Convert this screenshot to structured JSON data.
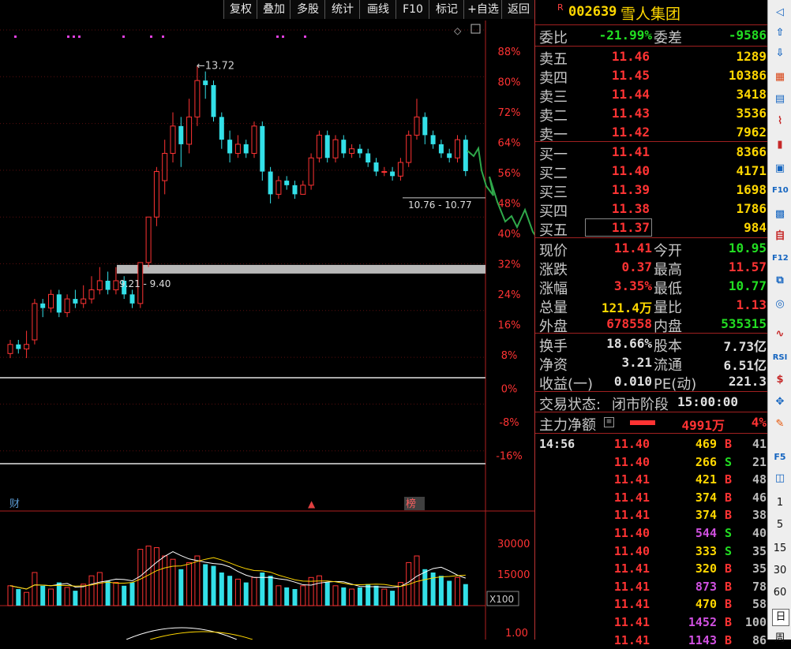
{
  "toolbar": {
    "buttons": [
      "复权",
      "叠加",
      "多股",
      "统计",
      "画线",
      "F10",
      "标记",
      "+自选",
      "返回"
    ]
  },
  "stock": {
    "badge": "R",
    "code": "002639",
    "name": "雪人集团"
  },
  "order_book": {
    "weibi_label": "委比",
    "weibi_value": "-21.99%",
    "weicha_label": "委差",
    "weicha_value": "-9586",
    "sells": [
      {
        "label": "卖五",
        "price": "11.46",
        "vol": "1289"
      },
      {
        "label": "卖四",
        "price": "11.45",
        "vol": "10386"
      },
      {
        "label": "卖三",
        "price": "11.44",
        "vol": "3418"
      },
      {
        "label": "卖二",
        "price": "11.43",
        "vol": "3536"
      },
      {
        "label": "卖一",
        "price": "11.42",
        "vol": "7962"
      }
    ],
    "buys": [
      {
        "label": "买一",
        "price": "11.41",
        "vol": "8366"
      },
      {
        "label": "买二",
        "price": "11.40",
        "vol": "4171"
      },
      {
        "label": "买三",
        "price": "11.39",
        "vol": "1698"
      },
      {
        "label": "买四",
        "price": "11.38",
        "vol": "1786"
      },
      {
        "label": "买五",
        "price": "11.37",
        "vol": "984"
      }
    ]
  },
  "stats": [
    {
      "l1": "现价",
      "v1": "11.41",
      "l2": "今开",
      "v2": "10.95"
    },
    {
      "l1": "涨跌",
      "v1": "0.37",
      "l2": "最高",
      "v2": "11.57"
    },
    {
      "l1": "涨幅",
      "v1": "3.35%",
      "l2": "最低",
      "v2": "10.77"
    },
    {
      "l1": "总量",
      "v1": "121.4万",
      "l2": "量比",
      "v2": "1.13"
    },
    {
      "l1": "外盘",
      "v1": "678558",
      "l2": "内盘",
      "v2": "535315"
    }
  ],
  "stats2": [
    {
      "l1": "换手",
      "v1": "18.66%",
      "l2": "股本",
      "v2": "7.73亿"
    },
    {
      "l1": "净资",
      "v1": "3.21",
      "l2": "流通",
      "v2": "6.51亿"
    },
    {
      "l1": "收益(一)",
      "v1": "0.010",
      "l2": "PE(动)",
      "v2": "221.3"
    }
  ],
  "trade_status": {
    "label": "交易状态:",
    "value": "闭市阶段",
    "time": "15:00:00"
  },
  "main_flow": {
    "label": "主力净额",
    "value": "4991万",
    "pct": "4%"
  },
  "ticks": [
    {
      "time": "14:56",
      "price": "11.40",
      "vol": "469",
      "side": "B",
      "n": "41"
    },
    {
      "time": "",
      "price": "11.40",
      "vol": "266",
      "side": "S",
      "n": "21"
    },
    {
      "time": "",
      "price": "11.41",
      "vol": "421",
      "side": "B",
      "n": "48"
    },
    {
      "time": "",
      "price": "11.41",
      "vol": "374",
      "side": "B",
      "n": "46"
    },
    {
      "time": "",
      "price": "11.41",
      "vol": "374",
      "side": "B",
      "n": "38"
    },
    {
      "time": "",
      "price": "11.40",
      "vol": "544",
      "side": "S",
      "n": "40"
    },
    {
      "time": "",
      "price": "11.40",
      "vol": "333",
      "side": "S",
      "n": "35"
    },
    {
      "time": "",
      "price": "11.41",
      "vol": "320",
      "side": "B",
      "n": "35"
    },
    {
      "time": "",
      "price": "11.41",
      "vol": "873",
      "side": "B",
      "n": "78"
    },
    {
      "time": "",
      "price": "11.41",
      "vol": "470",
      "side": "B",
      "n": "58"
    },
    {
      "time": "",
      "price": "11.41",
      "vol": "1452",
      "side": "B",
      "n": "100"
    },
    {
      "time": "",
      "price": "11.41",
      "vol": "1143",
      "side": "B",
      "n": "86"
    }
  ],
  "chart_data": {
    "type": "candlestick",
    "pct_axis": [
      "88%",
      "80%",
      "72%",
      "64%",
      "56%",
      "48%",
      "40%",
      "32%",
      "24%",
      "16%",
      "8%",
      "0%",
      "-8%",
      "-16%"
    ],
    "high_label": "13.72",
    "range_labels": [
      "10.76 - 10.77",
      "9.21 - 9.40"
    ],
    "vol_axis": [
      "30000",
      "15000"
    ],
    "vol_unit": "X100",
    "macd_label": "1.00",
    "markers": [
      "财",
      "榜"
    ],
    "candles": [
      [
        7.4,
        7.6,
        7.7,
        7.3
      ],
      [
        7.6,
        7.5,
        7.7,
        7.4
      ],
      [
        7.5,
        7.6,
        7.9,
        7.3
      ],
      [
        7.7,
        8.5,
        8.6,
        7.6
      ],
      [
        8.5,
        8.4,
        8.6,
        8.2
      ],
      [
        8.4,
        8.7,
        8.8,
        8.3
      ],
      [
        8.7,
        8.3,
        8.8,
        8.2
      ],
      [
        8.3,
        8.6,
        8.7,
        8.2
      ],
      [
        8.6,
        8.5,
        8.8,
        8.4
      ],
      [
        8.5,
        8.6,
        8.9,
        8.4
      ],
      [
        8.6,
        8.8,
        9.1,
        8.5
      ],
      [
        8.8,
        9.0,
        9.3,
        8.7
      ],
      [
        9.0,
        8.8,
        9.2,
        8.7
      ],
      [
        8.8,
        9.0,
        9.3,
        8.7
      ],
      [
        9.0,
        8.7,
        9.1,
        8.6
      ],
      [
        8.7,
        8.5,
        8.8,
        8.4
      ],
      [
        8.5,
        9.4,
        9.4,
        8.4
      ],
      [
        9.4,
        10.4,
        10.4,
        9.3
      ],
      [
        10.4,
        11.4,
        11.5,
        10.2
      ],
      [
        11.2,
        11.8,
        12.1,
        10.9
      ],
      [
        11.8,
        12.4,
        12.7,
        11.6
      ],
      [
        12.4,
        12.0,
        12.6,
        11.5
      ],
      [
        12.0,
        12.6,
        13.0,
        11.8
      ],
      [
        12.6,
        13.4,
        13.72,
        12.4
      ],
      [
        13.4,
        13.3,
        13.6,
        13.0
      ],
      [
        13.3,
        12.6,
        13.4,
        12.5
      ],
      [
        12.6,
        12.1,
        12.7,
        11.9
      ],
      [
        12.1,
        11.8,
        12.3,
        11.6
      ],
      [
        11.8,
        12.0,
        12.2,
        11.7
      ],
      [
        12.0,
        11.8,
        12.1,
        11.7
      ],
      [
        11.8,
        12.4,
        12.5,
        11.7
      ],
      [
        12.4,
        11.4,
        12.5,
        11.2
      ],
      [
        11.4,
        10.9,
        11.5,
        10.7
      ],
      [
        10.9,
        11.2,
        11.3,
        10.8
      ],
      [
        11.2,
        11.1,
        11.3,
        11.0
      ],
      [
        11.1,
        10.9,
        11.2,
        10.8
      ],
      [
        10.9,
        11.1,
        11.2,
        10.9
      ],
      [
        11.1,
        11.7,
        11.8,
        11.0
      ],
      [
        11.7,
        12.2,
        12.3,
        11.6
      ],
      [
        12.2,
        11.7,
        12.3,
        11.6
      ],
      [
        11.7,
        12.1,
        12.2,
        11.6
      ],
      [
        12.1,
        11.8,
        12.2,
        11.7
      ],
      [
        11.8,
        11.9,
        12.0,
        11.7
      ],
      [
        11.9,
        11.8,
        12.0,
        11.7
      ],
      [
        11.8,
        11.6,
        11.9,
        11.5
      ],
      [
        11.6,
        11.4,
        11.7,
        11.3
      ],
      [
        11.4,
        11.4,
        11.5,
        11.3
      ],
      [
        11.4,
        11.3,
        11.5,
        11.2
      ],
      [
        11.3,
        11.6,
        11.7,
        11.2
      ],
      [
        11.6,
        12.2,
        12.3,
        11.5
      ],
      [
        12.2,
        12.6,
        13.0,
        12.1
      ],
      [
        12.6,
        12.2,
        12.7,
        12.0
      ],
      [
        12.2,
        12.0,
        12.3,
        11.9
      ],
      [
        12.0,
        11.8,
        12.1,
        11.7
      ],
      [
        11.8,
        11.7,
        11.9,
        11.6
      ],
      [
        11.7,
        12.1,
        12.2,
        11.6
      ],
      [
        12.1,
        11.41,
        12.2,
        11.3
      ]
    ],
    "volumes": [
      12,
      10,
      8,
      20,
      12,
      10,
      14,
      11,
      9,
      13,
      18,
      20,
      15,
      14,
      12,
      14,
      34,
      36,
      35,
      30,
      28,
      22,
      26,
      30,
      25,
      24,
      20,
      18,
      16,
      14,
      17,
      20,
      18,
      12,
      11,
      10,
      12,
      17,
      18,
      14,
      12,
      11,
      10,
      11,
      13,
      12,
      10,
      9,
      14,
      26,
      30,
      22,
      20,
      18,
      15,
      17,
      13
    ]
  }
}
